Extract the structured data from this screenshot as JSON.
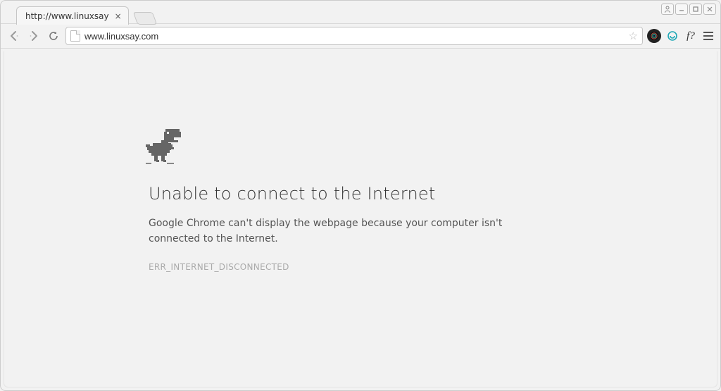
{
  "window": {
    "controls": {
      "user": "◇",
      "min": "—",
      "max": "□",
      "close": "✕"
    }
  },
  "tab": {
    "title": "http://www.linuxsay",
    "close": "×"
  },
  "toolbar": {
    "url": "www.linuxsay.com",
    "star": "☆",
    "ext3_label": "f?"
  },
  "error": {
    "title": "Unable to connect to the Internet",
    "body": "Google Chrome can't display the webpage because your computer isn't connected to the Internet.",
    "code": "ERR_INTERNET_DISCONNECTED"
  }
}
